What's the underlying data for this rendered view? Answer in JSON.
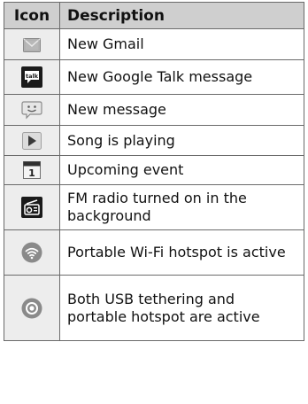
{
  "table": {
    "headers": {
      "icon": "Icon",
      "description": "Description"
    },
    "rows": [
      {
        "icon": "gmail-envelope-icon",
        "description": "New Gmail"
      },
      {
        "icon": "talk-bubble-icon",
        "icon_text": "talk",
        "description": "New Google Talk message"
      },
      {
        "icon": "smiley-message-icon",
        "description": "New message"
      },
      {
        "icon": "play-icon",
        "description": "Song is playing"
      },
      {
        "icon": "calendar-icon",
        "icon_text": "1",
        "description": "Upcoming event"
      },
      {
        "icon": "radio-icon",
        "description": "FM radio turned on in the background"
      },
      {
        "icon": "wifi-hotspot-icon",
        "description": "Portable Wi-Fi hotspot is active"
      },
      {
        "icon": "usb-tether-icon",
        "description": "Both USB tethering and portable hotspot are active"
      }
    ]
  },
  "colors": {
    "header_bg": "#cfcfcf",
    "border": "#6a6a6a",
    "icon_bg": "#ededed"
  }
}
